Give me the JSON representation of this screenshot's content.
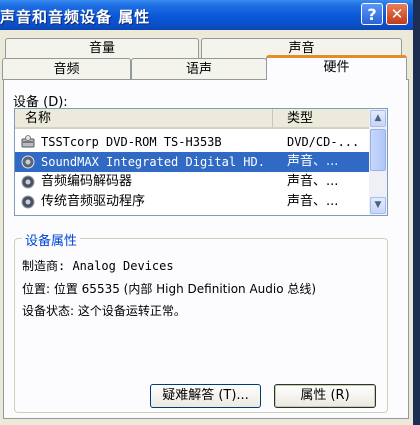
{
  "window": {
    "title": "声音和音频设备 属性"
  },
  "titlebar": {
    "help": "?",
    "close": "✕"
  },
  "tabs": {
    "back": [
      "音量",
      "声音"
    ],
    "front": [
      "音频",
      "语声",
      "硬件"
    ],
    "active": "硬件"
  },
  "devices_label": "设备 (D):",
  "list": {
    "headers": {
      "name": "名称",
      "type": "类型"
    },
    "rows": [
      {
        "name": "TSSTcorp DVD-ROM TS-H353B",
        "type": "DVD/CD-...",
        "icon": "cd-drive-icon"
      },
      {
        "name": "SoundMAX Integrated Digital HD...",
        "type": "声音、...",
        "icon": "speaker-icon",
        "selected": true
      },
      {
        "name": "音频编码解码器",
        "type": "声音、...",
        "icon": "speaker-icon"
      },
      {
        "name": "传统音频驱动程序",
        "type": "声音、...",
        "icon": "speaker-icon"
      }
    ]
  },
  "properties": {
    "title": "设备属性",
    "manufacturer": "制造商: Analog Devices",
    "location": "位置: 位置 65535 (内部 High Definition Audio 总线)",
    "status": "设备状态: 这个设备运转正常。"
  },
  "buttons": {
    "troubleshoot": "疑难解答 (T)...",
    "properties": "属性 (R)"
  }
}
